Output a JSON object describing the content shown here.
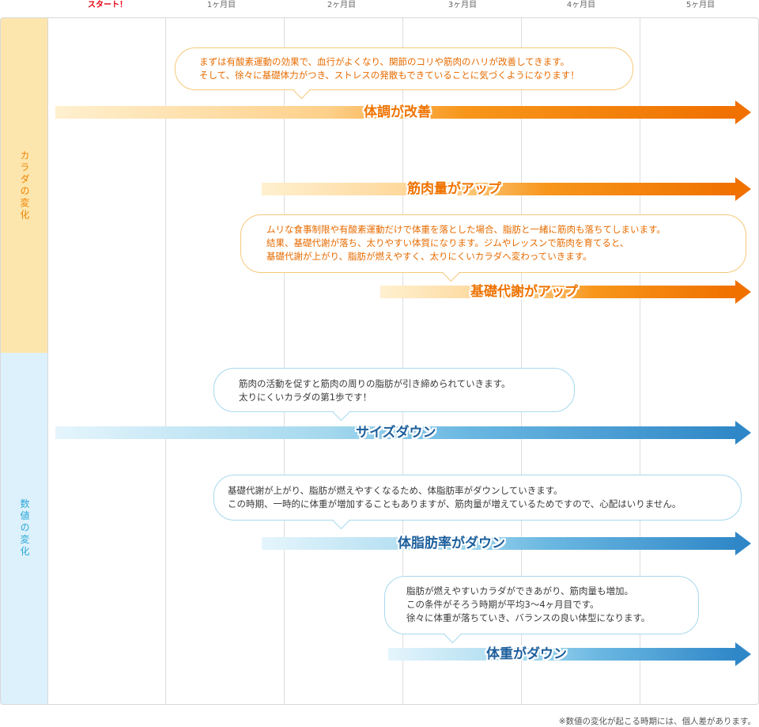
{
  "timeline": {
    "start": "スタート！",
    "months": [
      "1ヶ月目",
      "2ヶ月目",
      "3ヶ月目",
      "4ヶ月目",
      "5ヶ月目"
    ]
  },
  "body_section": {
    "label": "カラダの変化",
    "items": [
      {
        "bubble": [
          "まずは有酸素運動の効果で、血行がよくなり、関節のコリや筋肉のハリが改善してきます。",
          "そして、徐々に基礎体力がつき、ストレスの発散もできていることに気づくようになります！"
        ],
        "label": "体調が改善"
      },
      {
        "label": "筋肉量がアップ"
      },
      {
        "bubble": [
          "ムリな食事制限や有酸素運動だけで体重を落とした場合、脂肪と一緒に筋肉も落ちてしまいます。",
          "結果、基礎代謝が落ち、太りやすい体質になります。ジムやレッスンで筋肉を育てると、",
          "基礎代謝が上がり、脂肪が燃えやすく、太りにくいカラダへ変わっていきます。"
        ],
        "label": "基礎代謝がアップ"
      }
    ]
  },
  "numbers_section": {
    "label": "数値の変化",
    "items": [
      {
        "bubble": [
          "筋肉の活動を促すと筋肉の周りの脂肪が引き締められていきます。",
          "太りにくいカラダの第1歩です！"
        ],
        "label": "サイズダウン"
      },
      {
        "bubble": [
          "基礎代謝が上がり、脂肪が燃えやすくなるため、体脂肪率がダウンしていきます。",
          "この時期、一時的に体重が増加することもありますが、筋肉量が増えているためですので、心配はいりません。"
        ],
        "label": "体脂肪率がダウン"
      },
      {
        "bubble": [
          "脂肪が燃えやすいカラダができあがり、筋肉量も増加。",
          "この条件がそろう時期が平均3〜4ヶ月目です。",
          "徐々に体重が落ちていき、バランスの良い体型になります。"
        ],
        "label": "体重がダウン"
      }
    ]
  },
  "footnote": "※数値の変化が起こる時期には、個人差があります。"
}
